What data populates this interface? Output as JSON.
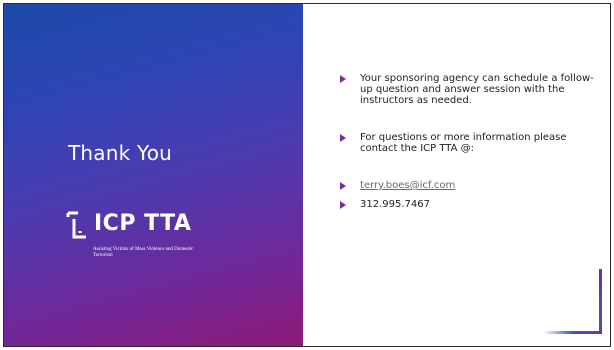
{
  "slide": {
    "title": "Thank You",
    "logo": {
      "name": "ICP TTA",
      "tagline": "Assisting Victims of Mass Violence and Domestic Terrorism"
    },
    "bullets": [
      {
        "text": "Your sponsoring agency can schedule a follow-up question and answer session with the instructors as needed."
      },
      {
        "text": "For questions or more information please contact the ICP TTA @:"
      },
      {
        "text": "terry.boes@icf.com"
      },
      {
        "text": "312.995.7467"
      }
    ]
  },
  "colors": {
    "gradient_start": "#1c4aa8",
    "gradient_end": "#8e1a78",
    "bullet_arrow": "#7b2c9a",
    "accent_line": "#7b2c9a"
  }
}
